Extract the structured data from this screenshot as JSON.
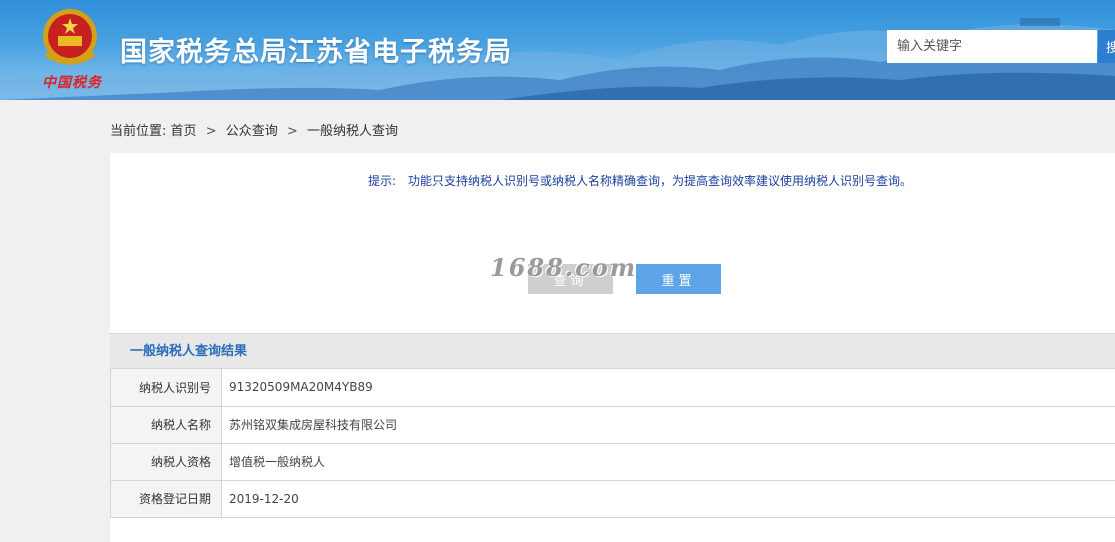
{
  "header": {
    "site_title": "国家税务总局江苏省电子税务局",
    "brand_signature": "中国税务",
    "search_placeholder": "输入关键字",
    "search_button_label": "搜"
  },
  "breadcrumb": {
    "label": "当前位置:",
    "items": [
      "首页",
      "公众查询",
      "一般纳税人查询"
    ],
    "separator": ">"
  },
  "notice": {
    "label": "提示:",
    "text": "功能只支持纳税人识别号或纳税人名称精确查询，为提高查询效率建议使用纳税人识别号查询。"
  },
  "buttons": {
    "query_label": "查询",
    "reset_label": "重置"
  },
  "watermark": "1688.com",
  "result": {
    "title": "一般纳税人查询结果",
    "rows": [
      {
        "key": "纳税人识别号",
        "value": "91320509MA20M4YB89"
      },
      {
        "key": "纳税人名称",
        "value": "苏州铭双集成房屋科技有限公司"
      },
      {
        "key": "纳税人资格",
        "value": "增值税一般纳税人"
      },
      {
        "key": "资格登记日期",
        "value": "2019-12-20"
      }
    ]
  },
  "colors": {
    "header_blue": "#2f8fd8",
    "notice_text": "#1a3f9e",
    "result_title": "#2a6db8",
    "reset_button": "#5da4e8",
    "query_button": "#cfcfcf"
  }
}
